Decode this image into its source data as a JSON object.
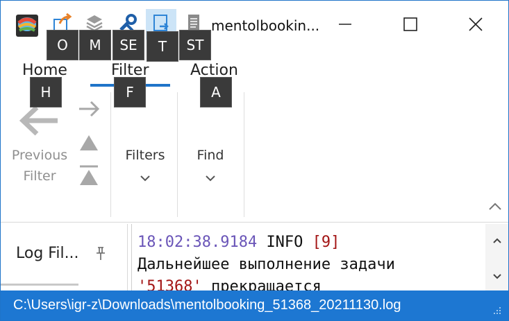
{
  "title_bar": {
    "title": "mentolbookin...",
    "quick_access": [
      {
        "icon": "open-file-icon"
      },
      {
        "icon": "merge-layers-icon"
      },
      {
        "icon": "settings-tools-icon"
      },
      {
        "icon": "tail-icon"
      },
      {
        "icon": "statistics-icon"
      }
    ],
    "controls": {
      "minimize": "minimize-icon",
      "maximize": "maximize-icon",
      "close": "close-icon"
    }
  },
  "keytips": {
    "open": "O",
    "merge": "M",
    "settings": "SE",
    "tail": "T",
    "stats": "ST",
    "home": "H",
    "filter": "F",
    "action": "A"
  },
  "tabs": [
    {
      "label": "Home"
    },
    {
      "label": "Filter",
      "active": true
    },
    {
      "label": "Action"
    }
  ],
  "ribbon": {
    "previous_filter_line1": "Previous",
    "previous_filter_line2": "Filter",
    "filters_label": "Filters",
    "find_label": "Find"
  },
  "log_files_panel": {
    "label": "Log Fil..."
  },
  "log_view": {
    "line1": {
      "time": "18:02:38.9184",
      "level": "INFO",
      "thread": "[9]"
    },
    "line2": "Дальнейшее выполнение задачи",
    "line3": {
      "quoted": "'51368'",
      "rest": "прекращается"
    }
  },
  "status_bar": {
    "path": "C:\\Users\\igr-z\\Downloads\\mentolbooking_51368_20211130.log"
  },
  "colors": {
    "accent": "#1f74c9",
    "status_bar": "#1d77d2",
    "keytip_bg": "#3a3a3a",
    "log_time": "#6a55b8",
    "log_thread": "#a31515"
  }
}
